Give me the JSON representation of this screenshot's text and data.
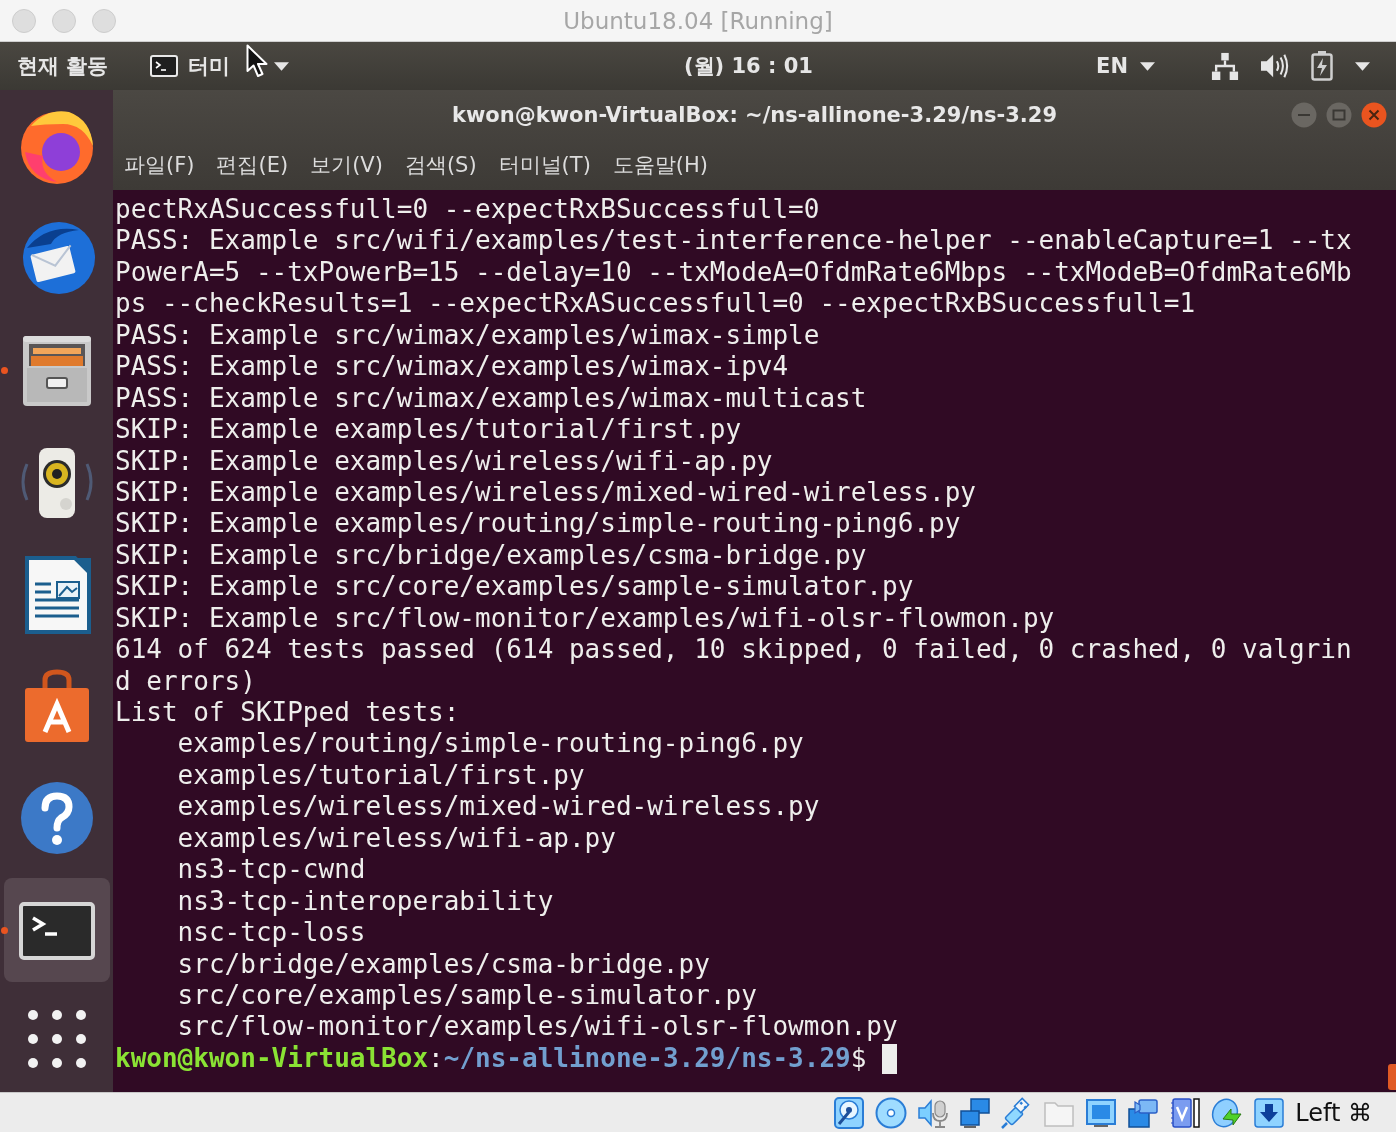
{
  "host_window": {
    "title": "Ubuntu18.04 [Running]"
  },
  "top_bar": {
    "activities": "현재 활동",
    "app_menu": "터미",
    "clock": "(월) 16 : 01",
    "keyboard_layout": "EN"
  },
  "dock": {
    "items": [
      {
        "kind": "browser",
        "running": false,
        "selected": false
      },
      {
        "kind": "mail",
        "running": false,
        "selected": false
      },
      {
        "kind": "files",
        "running": true,
        "selected": false
      },
      {
        "kind": "music",
        "running": false,
        "selected": false
      },
      {
        "kind": "writer",
        "running": false,
        "selected": false
      },
      {
        "kind": "store",
        "running": false,
        "selected": false
      },
      {
        "kind": "help",
        "running": false,
        "selected": false
      },
      {
        "kind": "terminal",
        "running": true,
        "selected": true
      }
    ]
  },
  "terminal": {
    "title": "kwon@kwon-VirtualBox: ~/ns-allinone-3.29/ns-3.29",
    "menu": [
      "파일(F)",
      "편집(E)",
      "보기(V)",
      "검색(S)",
      "터미널(T)",
      "도움말(H)"
    ],
    "lines": [
      "pectRxASuccessfull=0 --expectRxBSuccessfull=0",
      "PASS: Example src/wifi/examples/test-interference-helper --enableCapture=1 --tx",
      "PowerA=5 --txPowerB=15 --delay=10 --txModeA=OfdmRate6Mbps --txModeB=OfdmRate6Mb",
      "ps --checkResults=1 --expectRxASuccessfull=0 --expectRxBSuccessfull=1",
      "PASS: Example src/wimax/examples/wimax-simple",
      "PASS: Example src/wimax/examples/wimax-ipv4",
      "PASS: Example src/wimax/examples/wimax-multicast",
      "SKIP: Example examples/tutorial/first.py",
      "SKIP: Example examples/wireless/wifi-ap.py",
      "SKIP: Example examples/wireless/mixed-wired-wireless.py",
      "SKIP: Example examples/routing/simple-routing-ping6.py",
      "SKIP: Example src/bridge/examples/csma-bridge.py",
      "SKIP: Example src/core/examples/sample-simulator.py",
      "SKIP: Example src/flow-monitor/examples/wifi-olsr-flowmon.py",
      "614 of 624 tests passed (614 passed, 10 skipped, 0 failed, 0 crashed, 0 valgrin",
      "d errors)",
      "List of SKIPped tests:",
      "    examples/routing/simple-routing-ping6.py",
      "    examples/tutorial/first.py",
      "    examples/wireless/mixed-wired-wireless.py",
      "    examples/wireless/wifi-ap.py",
      "    ns3-tcp-cwnd",
      "    ns3-tcp-interoperability",
      "    nsc-tcp-loss",
      "    src/bridge/examples/csma-bridge.py",
      "    src/core/examples/sample-simulator.py",
      "    src/flow-monitor/examples/wifi-olsr-flowmon.py"
    ],
    "prompt": {
      "user": "kwon@kwon-VirtualBox",
      "separator": ":",
      "path": "~/ns-allinone-3.29/ns-3.29",
      "symbol": "$"
    }
  },
  "status_bar": {
    "indicators": [
      {
        "kind": "harddisk",
        "disabled": false
      },
      {
        "kind": "optical",
        "disabled": false
      },
      {
        "kind": "audio",
        "disabled": false
      },
      {
        "kind": "network",
        "disabled": false
      },
      {
        "kind": "usb",
        "disabled": false
      },
      {
        "kind": "shared",
        "disabled": true
      },
      {
        "kind": "display",
        "disabled": false
      },
      {
        "kind": "capture",
        "disabled": false
      },
      {
        "kind": "cpu",
        "disabled": false
      },
      {
        "kind": "mouse",
        "disabled": false
      },
      {
        "kind": "keyboard",
        "disabled": false
      }
    ],
    "host_key": "Left ⌘"
  }
}
